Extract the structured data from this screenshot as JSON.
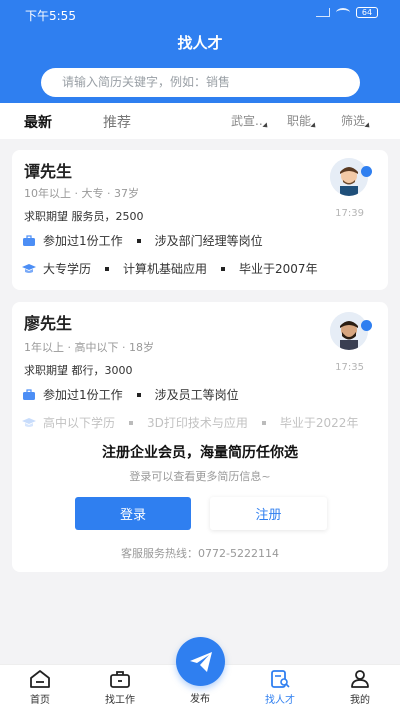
{
  "status": {
    "time": "下午5:55",
    "battery": "64"
  },
  "header": {
    "title": "找人才"
  },
  "search": {
    "placeholder": "请输入简历关键字，例如：销售"
  },
  "tabs": {
    "latest": "最新",
    "recommend": "推荐"
  },
  "filters": {
    "location": "武宣..",
    "function": "职能",
    "more": "筛选"
  },
  "cards": [
    {
      "name": "谭先生",
      "meta": "10年以上 · 大专 · 37岁",
      "expect": "求职期望 服务员，2500",
      "work": [
        "参加过1份工作",
        "涉及部门经理等岗位"
      ],
      "edu": [
        "大专学历",
        "计算机基础应用",
        "毕业于2007年"
      ],
      "time": "17:39"
    },
    {
      "name": "廖先生",
      "meta": "1年以上 · 高中以下 · 18岁",
      "expect": "求职期望 都行，3000",
      "work": [
        "参加过1份工作",
        "涉及员工等岗位"
      ],
      "edu": [
        "高中以下学历",
        "3D打印技术与应用",
        "毕业于2022年"
      ],
      "time": "17:35"
    }
  ],
  "login": {
    "title": "注册企业会员，海量简历任你选",
    "subtitle": "登录可以查看更多简历信息~",
    "login_label": "登录",
    "register_label": "注册",
    "hotline": "客服服务热线：0772-5222114"
  },
  "nav": {
    "home": "首页",
    "jobs": "找工作",
    "publish": "发布",
    "talent": "找人才",
    "mine": "我的"
  },
  "colors": {
    "accent": "#2f7ff0"
  }
}
